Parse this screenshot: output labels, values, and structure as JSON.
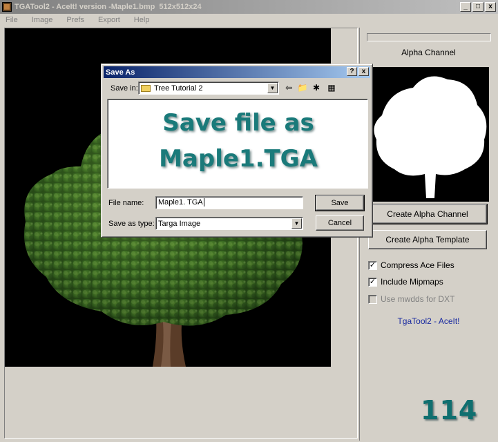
{
  "window": {
    "title": "TGATool2 - AceIt! version -Maple1.bmp  512x512x24",
    "minimize": "_",
    "maximize": "□",
    "close": "x"
  },
  "menu": [
    "File",
    "Image",
    "Prefs",
    "Export",
    "Help"
  ],
  "right_panel": {
    "alpha_label": "Alpha Channel",
    "create_alpha_channel": "Create Alpha Channel",
    "create_alpha_template": "Create Alpha Template",
    "compress_ace": {
      "label": "Compress Ace Files",
      "checked": true
    },
    "include_mipmaps": {
      "label": "Include Mipmaps",
      "checked": true
    },
    "use_mwdds": {
      "label": "Use mwdds for DXT",
      "checked": false,
      "enabled": false
    },
    "footer": "TgaTool2 - AceIt!"
  },
  "dialog": {
    "title": "Save As",
    "help": "?",
    "close": "x",
    "save_in_label": "Save in:",
    "save_in_value": "Tree Tutorial 2",
    "overlay_line1": "Save file as",
    "overlay_line2": "Maple1.TGA",
    "file_name_label": "File name:",
    "file_name_value": "Maple1. TGA",
    "save_as_type_label": "Save as type:",
    "save_as_type_value": "Targa Image",
    "save_button": "Save",
    "cancel_button": "Cancel"
  },
  "page_number": "114",
  "colors": {
    "title_active": "#0a246a",
    "overlay_text": "#1a7a7a",
    "footer_link": "#1a2aa0",
    "page_number": "#0f6f6f"
  }
}
